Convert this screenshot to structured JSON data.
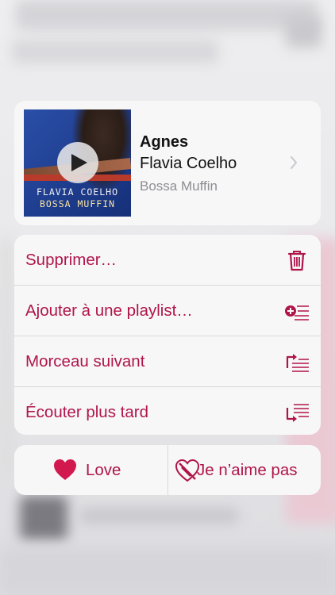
{
  "song": {
    "title": "Agnes",
    "artist": "Flavia Coelho",
    "album": "Bossa Muffin",
    "artwork_text_line1": "FLAVIA COELHO",
    "artwork_text_line2": "BOSSA MUFFIN"
  },
  "actions": [
    {
      "label": "Supprimer…",
      "icon": "trash-icon"
    },
    {
      "label": "Ajouter à une playlist…",
      "icon": "add-to-playlist-icon"
    },
    {
      "label": "Morceau suivant",
      "icon": "play-next-icon"
    },
    {
      "label": "Écouter plus tard",
      "icon": "play-later-icon"
    }
  ],
  "rating": {
    "love_label": "Love",
    "dislike_label": "Je n’aime pas"
  },
  "colors": {
    "accent": "#b0154a",
    "secondary_text": "#8e8e93"
  }
}
